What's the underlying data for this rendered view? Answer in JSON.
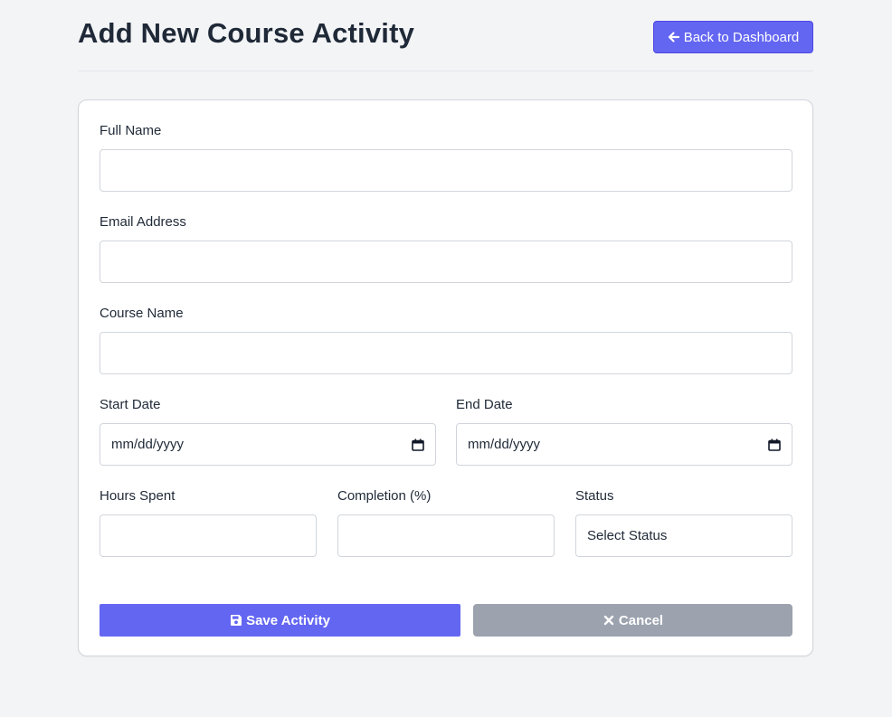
{
  "header": {
    "title": "Add New Course Activity",
    "back_label": "Back to Dashboard"
  },
  "form": {
    "full_name": {
      "label": "Full Name",
      "value": ""
    },
    "email": {
      "label": "Email Address",
      "value": ""
    },
    "course_name": {
      "label": "Course Name",
      "value": ""
    },
    "start_date": {
      "label": "Start Date",
      "placeholder": "mm/dd/yyyy"
    },
    "end_date": {
      "label": "End Date",
      "placeholder": "mm/dd/yyyy"
    },
    "hours_spent": {
      "label": "Hours Spent",
      "value": ""
    },
    "completion": {
      "label": "Completion (%)",
      "value": ""
    },
    "status": {
      "label": "Status",
      "selected": "Select Status"
    }
  },
  "actions": {
    "save_label": "Save Activity",
    "cancel_label": "Cancel"
  },
  "icons": {
    "back": "arrow-left-icon",
    "calendar": "calendar-icon",
    "save": "floppy-disk-icon",
    "cancel": "x-icon"
  },
  "colors": {
    "accent": "#6366f1",
    "cancel": "#9ca3af",
    "background": "#f3f4f6"
  }
}
